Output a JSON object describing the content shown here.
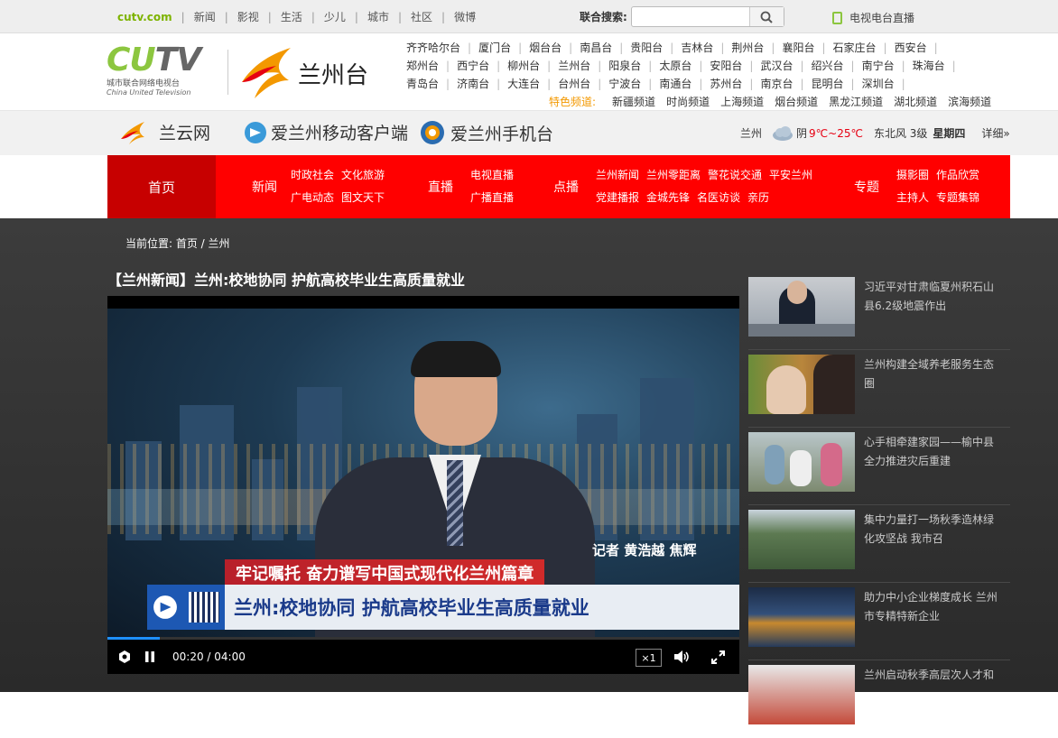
{
  "topbar": {
    "brand": "cutv.com",
    "links": [
      "新闻",
      "影视",
      "生活",
      "少儿",
      "城市",
      "社区",
      "微博"
    ],
    "search_label": "联合搜索:",
    "search_placeholder": "",
    "tv_live": "电视电台直播"
  },
  "header": {
    "logo_text_1": "CU",
    "logo_text_2": "TV",
    "logo_cn": "城市联合网络电视台",
    "logo_en": "China United Television",
    "station_name": "兰州台",
    "cities_row1": [
      "齐齐哈尔台",
      "厦门台",
      "烟台台",
      "南昌台",
      "贵阳台",
      "吉林台",
      "荆州台",
      "襄阳台",
      "石家庄台",
      "西安台"
    ],
    "cities_row2": [
      "郑州台",
      "西宁台",
      "柳州台",
      "兰州台",
      "阳泉台",
      "太原台",
      "安阳台",
      "武汉台",
      "绍兴台",
      "南宁台",
      "珠海台"
    ],
    "cities_row3": [
      "青岛台",
      "济南台",
      "大连台",
      "台州台",
      "宁波台",
      "南通台",
      "苏州台",
      "南京台",
      "昆明台",
      "深圳台"
    ],
    "featured_label": "特色频道:",
    "featured": [
      "新疆频道",
      "时尚频道",
      "上海频道",
      "烟台频道",
      "黑龙江频道",
      "湖北频道",
      "滨海频道"
    ]
  },
  "subbar": {
    "lanyun": "兰云网",
    "app": "爱兰州移动客户端",
    "mobile": "爱兰州手机台",
    "weather": {
      "city": "兰州",
      "cond": "阴",
      "temp": "9℃~25℃",
      "wind": "东北风 3级",
      "day": "星期四",
      "more": "详细»"
    }
  },
  "nav": {
    "home": "首页",
    "news": "新闻",
    "news_links": [
      [
        "时政社会",
        "文化旅游"
      ],
      [
        "广电动态",
        "图文天下"
      ]
    ],
    "live": "直播",
    "live_links": [
      [
        "电视直播"
      ],
      [
        "广播直播"
      ]
    ],
    "vod": "点播",
    "vod_links": [
      [
        "兰州新闻",
        "兰州零距离",
        "警花说交通",
        "平安兰州"
      ],
      [
        "党建播报",
        "金城先锋",
        "名医访谈",
        "亲历"
      ]
    ],
    "topic": "专题",
    "topic_links": [
      [
        "摄影圈",
        "作品欣赏"
      ],
      [
        "主持人",
        "专题集锦"
      ]
    ]
  },
  "article": {
    "crumb": "当前位置: 首页 / 兰州",
    "title": "【兰州新闻】兰州:校地协同 护航高校毕业生高质量就业",
    "reporter": "记者  黄浩越 焦辉",
    "banner_top": "牢记嘱托 奋力谱写中国式现代化兰州篇章",
    "banner_main": "兰州:校地协同 护航高校毕业生高质量就业",
    "time": "00:20 / 04:00",
    "progress": 0.083,
    "speed": "×1"
  },
  "sidebar": [
    {
      "caption": "习近平对甘肃临夏州积石山县6.2级地震作出"
    },
    {
      "caption": "兰州构建全域养老服务生态圈"
    },
    {
      "caption": "心手相牵建家园——榆中县全力推进灾后重建"
    },
    {
      "caption": "集中力量打一场秋季造林绿化攻坚战 我市召"
    },
    {
      "caption": "助力中小企业梯度成长 兰州市专精特新企业"
    },
    {
      "caption": "兰州启动秋季高层次人才和"
    }
  ],
  "colors": {
    "accent": "#ff0000",
    "home_bg": "#c70000",
    "brand_green": "#8cc63f",
    "featured": "#f39800"
  }
}
